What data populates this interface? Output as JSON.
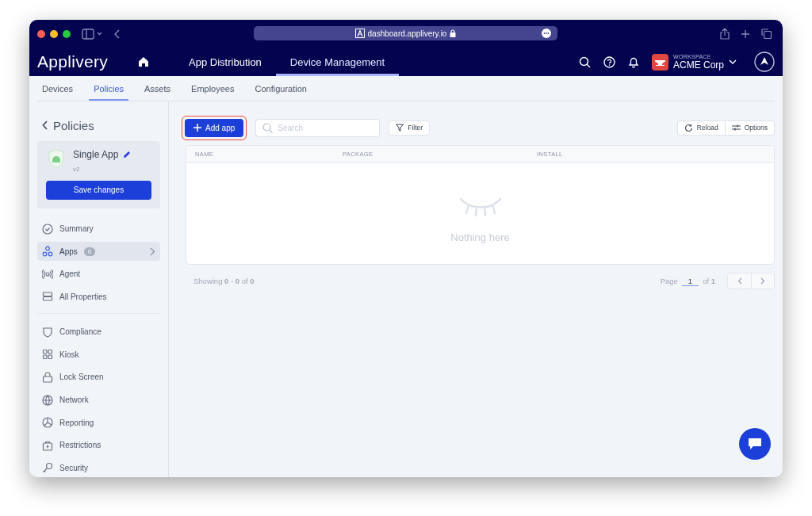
{
  "browser": {
    "url": "dashboard.applivery.io"
  },
  "header": {
    "logo": "Applivery",
    "nav": [
      {
        "label": "App Distribution",
        "selected": false
      },
      {
        "label": "Device Management",
        "selected": true
      }
    ],
    "workspace": {
      "label": "WORKSPACE",
      "name": "ACME Corp"
    }
  },
  "sub_tabs": [
    {
      "label": "Devices",
      "selected": false
    },
    {
      "label": "Policies",
      "selected": true
    },
    {
      "label": "Assets",
      "selected": false
    },
    {
      "label": "Employees",
      "selected": false
    },
    {
      "label": "Configuration",
      "selected": false
    }
  ],
  "sidebar": {
    "back_label": "Policies",
    "policy": {
      "name": "Single App",
      "version": "v2",
      "save_button": "Save changes"
    },
    "sections": [
      [
        {
          "label": "Summary",
          "selected": false
        },
        {
          "label": "Apps",
          "selected": true,
          "badge": "0"
        },
        {
          "label": "Agent",
          "selected": false
        },
        {
          "label": "All Properties",
          "selected": false
        }
      ],
      [
        {
          "label": "Compliance",
          "selected": false
        },
        {
          "label": "Kiosk",
          "selected": false
        },
        {
          "label": "Lock Screen",
          "selected": false
        },
        {
          "label": "Network",
          "selected": false
        },
        {
          "label": "Reporting",
          "selected": false
        },
        {
          "label": "Restrictions",
          "selected": false
        },
        {
          "label": "Security",
          "selected": false
        }
      ]
    ]
  },
  "toolbar": {
    "add_button": {
      "label": "Add app",
      "highlighted": true
    },
    "search": {
      "placeholder": "Search"
    },
    "filter_button": "Filter",
    "reload_button": "Reload",
    "options_button": "Options"
  },
  "table": {
    "columns": [
      "NAME",
      "PACKAGE",
      "INSTALL"
    ],
    "empty_text": "Nothing here"
  },
  "pagination": {
    "showing": "Showing **0** - **0** of **0**",
    "page_label": "Page",
    "page": "1",
    "total": "of **1**"
  }
}
